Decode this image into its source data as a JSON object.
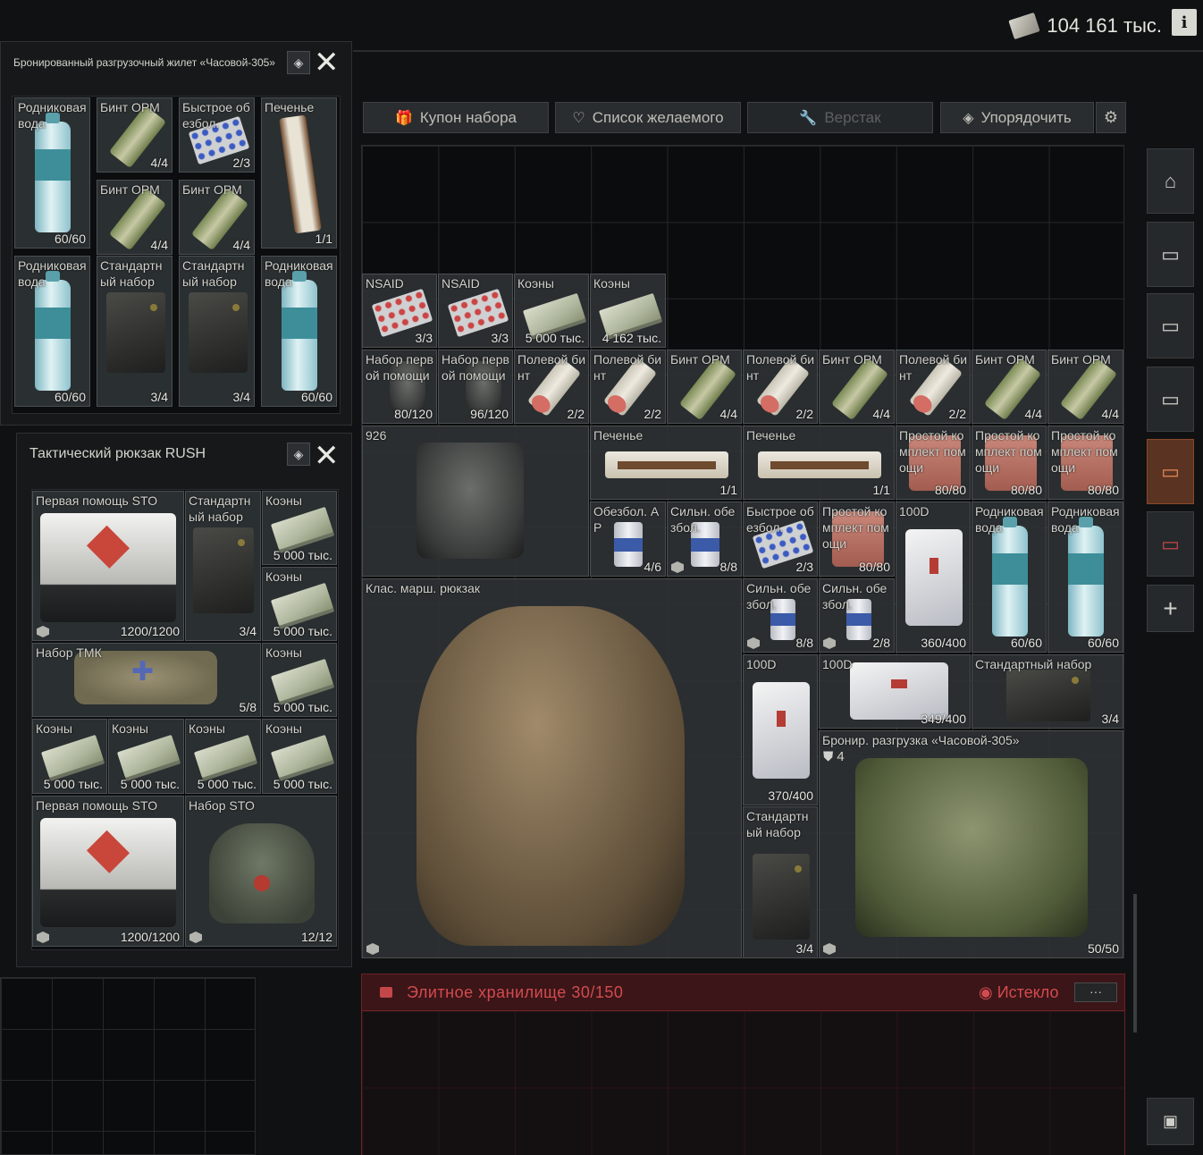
{
  "header": {
    "money_value": "104 161 тыс.",
    "info_label": "i"
  },
  "toolbar": {
    "coupon": "Купон набора",
    "wishlist": "Список желаемого",
    "workbench": "Верстак",
    "sort": "Упорядочить"
  },
  "rig_window": {
    "title": "Бронированный разгрузочный жилет «Часовой-305»",
    "items": [
      {
        "name": "Родниковая вода",
        "count": "60/60"
      },
      {
        "name": "Бинт ОРМ",
        "count": "4/4"
      },
      {
        "name": "Быстрое обезбол.",
        "count": "2/3"
      },
      {
        "name": "Печенье",
        "count": "1/1"
      },
      {
        "name": "Бинт ОРМ",
        "count": "4/4"
      },
      {
        "name": "Бинт ОРМ",
        "count": "4/4"
      },
      {
        "name": "Родниковая вода",
        "count": "60/60"
      },
      {
        "name": "Стандартный набор",
        "count": "3/4"
      },
      {
        "name": "Стандартный набор",
        "count": "3/4"
      },
      {
        "name": "Родниковая вода",
        "count": "60/60"
      }
    ]
  },
  "rush_window": {
    "title": "Тактический рюкзак RUSH",
    "items": [
      {
        "name": "Первая помощь STO",
        "count": "1200/1200"
      },
      {
        "name": "Стандартный набор",
        "count": "3/4"
      },
      {
        "name": "Коэны",
        "count": "5 000 тыс."
      },
      {
        "name": "Коэны",
        "count": "5 000 тыс."
      },
      {
        "name": "Набор ТМК",
        "count": "5/8"
      },
      {
        "name": "Коэны",
        "count": "5 000 тыс."
      },
      {
        "name": "Коэны",
        "count": "5 000 тыс."
      },
      {
        "name": "Коэны",
        "count": "5 000 тыс."
      },
      {
        "name": "Коэны",
        "count": "5 000 тыс."
      },
      {
        "name": "Коэны",
        "count": "5 000 тыс."
      },
      {
        "name": "Первая помощь STO",
        "count": "1200/1200"
      },
      {
        "name": "Набор STO",
        "count": "12/12"
      }
    ]
  },
  "stash": {
    "items": [
      {
        "name": "NSAID",
        "count": "3/3"
      },
      {
        "name": "NSAID",
        "count": "3/3"
      },
      {
        "name": "Коэны",
        "count": "5 000 тыс."
      },
      {
        "name": "Коэны",
        "count": "4 162 тыс."
      },
      {
        "name": "Набор первой помощи",
        "count": "80/120"
      },
      {
        "name": "Набор первой помощи",
        "count": "96/120"
      },
      {
        "name": "Полевой бинт",
        "count": "2/2"
      },
      {
        "name": "Полевой бинт",
        "count": "2/2"
      },
      {
        "name": "Бинт ОРМ",
        "count": "4/4"
      },
      {
        "name": "Полевой бинт",
        "count": "2/2"
      },
      {
        "name": "Бинт ОРМ",
        "count": "4/4"
      },
      {
        "name": "Полевой бинт",
        "count": "2/2"
      },
      {
        "name": "Бинт ОРМ",
        "count": "4/4"
      },
      {
        "name": "Бинт ОРМ",
        "count": "4/4"
      },
      {
        "name": "926",
        "count": ""
      },
      {
        "name": "Печенье",
        "count": "1/1"
      },
      {
        "name": "Печенье",
        "count": "1/1"
      },
      {
        "name": "Простой комплект помощи",
        "count": "80/80"
      },
      {
        "name": "Простой комплект помощи",
        "count": "80/80"
      },
      {
        "name": "Простой комплект помощи",
        "count": "80/80"
      },
      {
        "name": "Обезбол. АР",
        "count": "4/6"
      },
      {
        "name": "Сильн. обезбол.",
        "count": "8/8"
      },
      {
        "name": "Быстрое обезбол.",
        "count": "2/3"
      },
      {
        "name": "Простой комплект помощи",
        "count": "80/80"
      },
      {
        "name": "100D",
        "count": "360/400"
      },
      {
        "name": "Родниковая вода",
        "count": "60/60"
      },
      {
        "name": "Родниковая вода",
        "count": "60/60"
      },
      {
        "name": "Клас. марш. рюкзак",
        "count": ""
      },
      {
        "name": "Сильн. обезбол.",
        "count": "8/8"
      },
      {
        "name": "Сильн. обезбол.",
        "count": "2/8"
      },
      {
        "name": "100D",
        "count": "370/400"
      },
      {
        "name": "100D",
        "count": "349/400"
      },
      {
        "name": "Стандартный набор",
        "count": "3/4"
      },
      {
        "name": "Бронир. разгрузка «Часовой-305»",
        "count": "50/50",
        "armor": "4"
      },
      {
        "name": "Стандартный набор",
        "count": "3/4"
      }
    ]
  },
  "elite_storage": {
    "title": "Элитное хранилище",
    "capacity": "30/150",
    "status": "Истекло",
    "more": "···"
  },
  "sidebar": {
    "add_label": "+"
  },
  "colors": {
    "accent_red": "#d24b4f",
    "active_tab": "#e38a56"
  }
}
